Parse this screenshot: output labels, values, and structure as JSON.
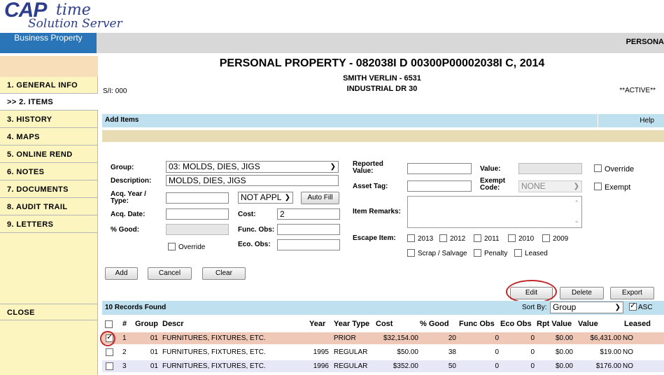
{
  "header": {
    "logo_cap": "CAP",
    "logo_time": "time",
    "logo_sub": "Solution Server",
    "tab": "Business Property",
    "right_label": "PERSONA"
  },
  "sidebar": {
    "items": [
      {
        "label": "1. GENERAL INFO"
      },
      {
        "label": ">> 2. ITEMS"
      },
      {
        "label": "3. HISTORY"
      },
      {
        "label": "4. MAPS"
      },
      {
        "label": "5. ONLINE REND"
      },
      {
        "label": "6. NOTES"
      },
      {
        "label": "7. DOCUMENTS"
      },
      {
        "label": "8. AUDIT TRAIL"
      },
      {
        "label": "9. LETTERS"
      }
    ],
    "close": "CLOSE"
  },
  "record": {
    "title": "PERSONAL PROPERTY - 082038I D 00300P00002038I C, 2014",
    "owner": "SMITH VERLIN - 6531",
    "address": "INDUSTRIAL DR 30",
    "si": "S/I: 000",
    "status": "**ACTIVE**"
  },
  "add_items": {
    "title": "Add Items",
    "help": "Help",
    "group_label": "Group:",
    "group_value": "03: MOLDS, DIES, JIGS",
    "description_label": "Description:",
    "description_value": "MOLDS, DIES, JIGS",
    "acq_year_label": "Acq. Year / Type:",
    "acq_year_value": "",
    "year_type_value": "NOT APPL",
    "auto_fill": "Auto Fill",
    "acq_date_label": "Acq. Date:",
    "acq_date_value": "",
    "cost_label": "Cost:",
    "cost_value": "2",
    "pct_good_label": "% Good:",
    "pct_good_value": "",
    "func_obs_label": "Func. Obs:",
    "func_obs_value": "",
    "eco_obs_label": "Eco. Obs:",
    "eco_obs_value": "",
    "override_label": "Override",
    "reported_value_label": "Reported Value:",
    "reported_value": "",
    "asset_tag_label": "Asset Tag:",
    "asset_tag": "",
    "item_remarks_label": "Item Remarks:",
    "escape_item_label": "Escape Item:",
    "escape_years": [
      "2013",
      "2012",
      "2011",
      "2010",
      "2009"
    ],
    "scrap_label": "Scrap / Salvage",
    "penalty_label": "Penalty",
    "leased_label": "Leased",
    "value_label": "Value:",
    "value": "",
    "exempt_code_label": "Exempt Code:",
    "exempt_code_value": "NONE",
    "override_right_label": "Override",
    "exempt_label": "Exempt",
    "add_button": "Add",
    "cancel_button": "Cancel",
    "clear_button": "Clear"
  },
  "actions": {
    "edit": "Edit",
    "delete": "Delete",
    "export": "Export"
  },
  "records": {
    "count_label": "10 Records Found",
    "sort_by_label": "Sort By:",
    "sort_by_value": "Group",
    "asc_label": "ASC",
    "columns": [
      "#",
      "Group",
      "Descr",
      "Year",
      "Year Type",
      "Cost",
      "% Good",
      "Func Obs",
      "Eco Obs",
      "Rpt Value",
      "Value",
      "Leased"
    ],
    "rows": [
      {
        "num": "1",
        "group": "01",
        "descr": "FURNITURES, FIXTURES, ETC.",
        "year": "",
        "year_type": "PRIOR",
        "cost": "$32,154.00",
        "good": "20",
        "func": "0",
        "eco": "0",
        "rpt": "$0.00",
        "value": "$6,431.00",
        "leased": "NO",
        "checked": true
      },
      {
        "num": "2",
        "group": "01",
        "descr": "FURNITURES, FIXTURES, ETC.",
        "year": "1995",
        "year_type": "REGULAR",
        "cost": "$50.00",
        "good": "38",
        "func": "0",
        "eco": "0",
        "rpt": "$0.00",
        "value": "$19.00",
        "leased": "NO",
        "checked": false
      },
      {
        "num": "3",
        "group": "01",
        "descr": "FURNITURES, FIXTURES, ETC.",
        "year": "1996",
        "year_type": "REGULAR",
        "cost": "$352.00",
        "good": "50",
        "func": "0",
        "eco": "0",
        "rpt": "$0.00",
        "value": "$176.00",
        "leased": "NO",
        "checked": false
      }
    ]
  },
  "colors": {
    "blue_tab": "#2a74b8",
    "sidebar_bg": "#fdf5c0",
    "light_blue_bar": "#bfe0ee",
    "selected_row": "#efc8b8",
    "alt_row": "#e6e8f8",
    "annotation_red": "#c0282a"
  }
}
